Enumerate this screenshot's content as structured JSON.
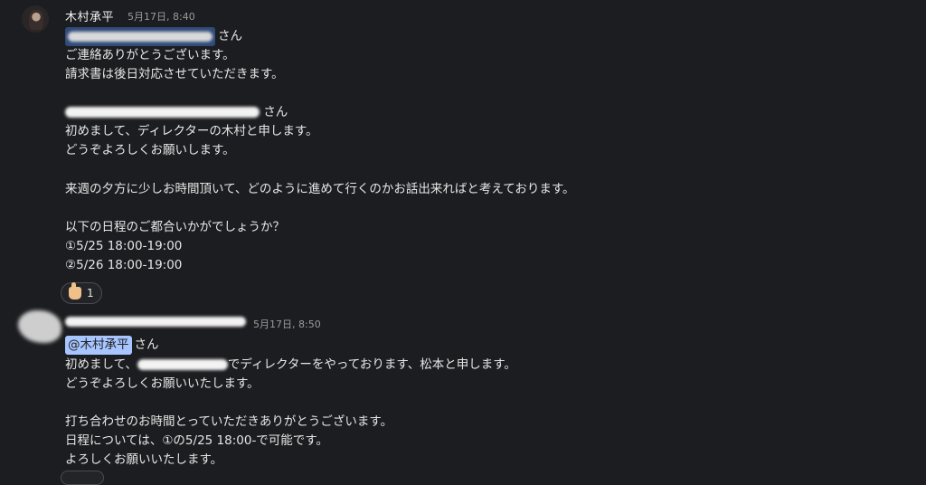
{
  "messages": [
    {
      "author": "木村承平",
      "timestamp": "5月17日, 8:40",
      "lines": {
        "l1_suffix": "さん",
        "l2": "ご連絡ありがとうございます。",
        "l3": "請求書は後日対応させていただきます。",
        "l4_suffix": "さん",
        "l5": "初めまして、ディレクターの木村と申します。",
        "l6": "どうぞよろしくお願いします。",
        "l7": "来週の夕方に少しお時間頂いて、どのように進めて行くのかお話出来ればと考えております。",
        "l8": "以下の日程のご都合いかがでしょうか？",
        "l9": "①5/25 18:00-19:00",
        "l10": "②5/26 18:00-19:00"
      },
      "reaction": {
        "icon": "thumbs-up-icon",
        "count": "1"
      }
    },
    {
      "author": "",
      "timestamp": "5月17日, 8:50",
      "lines": {
        "mention": "@木村承平",
        "l1_suffix": "さん",
        "l2_prefix": "初めまして、",
        "l2_suffix": "でディレクターをやっております、松本と申します。",
        "l3": "どうぞよろしくお願いいたします。",
        "l4": "打ち合わせのお時間とっていただきありがとうございます。",
        "l5": "日程については、①の5/25 18:00-で可能です。",
        "l6": "よろしくお願いいたします。"
      }
    }
  ],
  "colors": {
    "background": "#1c1d20",
    "mention_bg": "#a7c5ff",
    "text": "#e6e6e6",
    "timestamp": "#9b9b9b"
  }
}
